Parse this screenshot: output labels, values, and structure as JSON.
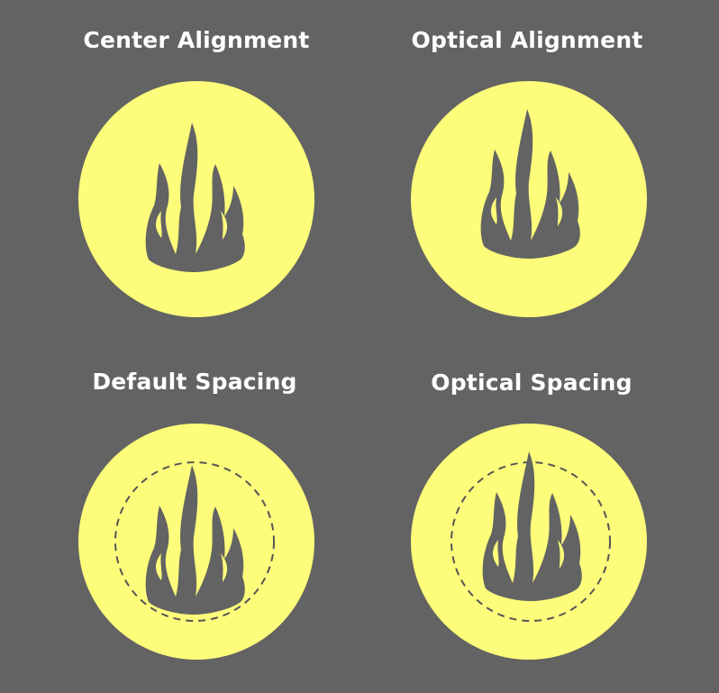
{
  "panels": [
    {
      "title": "Center Alignment",
      "icon": "flame-icon",
      "guide": false
    },
    {
      "title": "Optical Alignment",
      "icon": "flame-icon",
      "guide": false
    },
    {
      "title": "Default Spacing",
      "icon": "flame-icon",
      "guide": true
    },
    {
      "title": "Optical Spacing",
      "icon": "flame-icon",
      "guide": true
    }
  ],
  "colors": {
    "background": "#636363",
    "circle": "#fdfd7b",
    "flame": "#636363",
    "title": "#ffffff",
    "guide": "#555555"
  }
}
